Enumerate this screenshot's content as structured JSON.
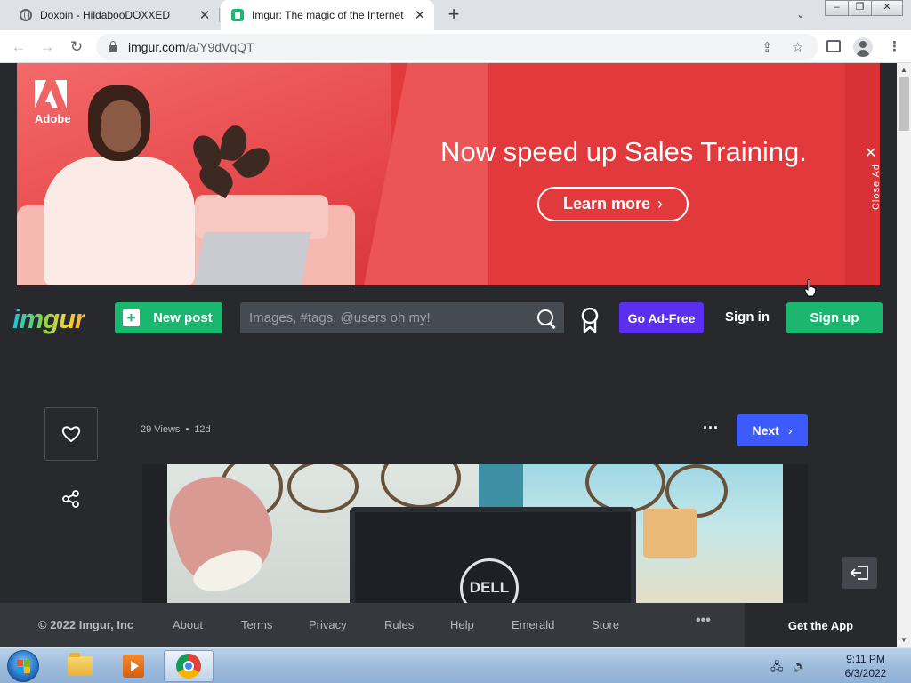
{
  "browser": {
    "tabs": [
      {
        "title": "Doxbin - HildabooDOXXED",
        "active": false,
        "icon": "globe-icon"
      },
      {
        "title": "Imgur: The magic of the Internet",
        "active": true,
        "icon": "imgur-favicon"
      }
    ],
    "url_host": "imgur.com",
    "url_path": "/a/Y9dVqQT"
  },
  "ad": {
    "brand": "Adobe",
    "headline": "Now speed up Sales Training.",
    "cta_label": "Learn more",
    "close_label": "Close Ad",
    "colors": {
      "background": "#e2393d"
    }
  },
  "header": {
    "logo": "imgur",
    "new_post_label": "New post",
    "search_placeholder": "Images, #tags, @users oh my!",
    "go_ad_free_label": "Go Ad-Free",
    "sign_in_label": "Sign in",
    "sign_up_label": "Sign up",
    "colors": {
      "green": "#1bb76e",
      "purple": "#5b2ff0"
    }
  },
  "post": {
    "views": "29 Views",
    "age": "12d",
    "next_label": "Next",
    "image_text": "DELL",
    "colors": {
      "next": "#3d5afe"
    }
  },
  "footer": {
    "copyright": "© 2022 Imgur, Inc",
    "links": [
      "About",
      "Terms",
      "Privacy",
      "Rules",
      "Help",
      "Emerald",
      "Store"
    ],
    "more": "•••",
    "get_app_label": "Get the App"
  },
  "taskbar": {
    "time": "9:11 PM",
    "date": "6/3/2022",
    "apps": [
      "folder-icon",
      "media-player-icon",
      "chrome-icon"
    ]
  }
}
